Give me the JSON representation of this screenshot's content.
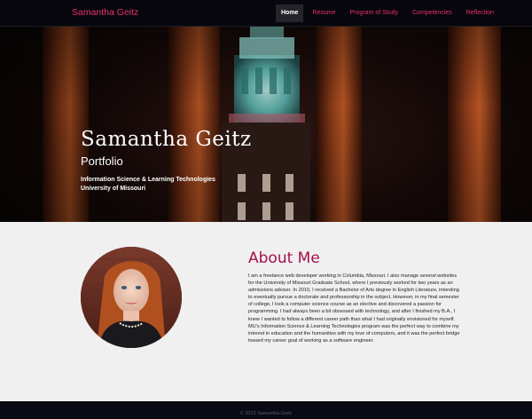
{
  "navbar": {
    "brand": "Samantha Geitz",
    "items": [
      {
        "label": "Home",
        "active": true
      },
      {
        "label": "Resume",
        "active": false
      },
      {
        "label": "Program of Study",
        "active": false
      },
      {
        "label": "Competencies",
        "active": false
      },
      {
        "label": "Reflection",
        "active": false
      }
    ]
  },
  "hero": {
    "name": "Samantha Geitz",
    "subtitle": "Portfolio",
    "line1": "Information Science & Learning Technologies",
    "line2": "University of Missouri"
  },
  "about": {
    "title": "About Me",
    "body": "I am a freelance web developer working in Columbia, Missouri. I also manage several websites for the University of Missouri Graduate School, where I previously worked for two years as an admissions adviser. In 2010, I received a Bachelor of Arts degree in English Literature, intending to eventually pursue a doctorate and professorship in the subject. However, in my final semester of college, I took a computer science course as an elective and discovered a passion for programming. I had always been a bit obsessed with technology, and after I finished my B.A., I knew I wanted to follow a different career path than what I had originally envisioned for myself. MU's Information Science & Learning Technologies program was the perfect way to combine my interest in education and the humanities with my love of computers, and it was the perfect bridge toward my career goal of working as a software engineer."
  },
  "footer": {
    "text": "© 2013 Samantha Geitz"
  },
  "colors": {
    "accent": "#e8306e",
    "heading": "#a30f4c",
    "navbar_bg": "#07070d",
    "footer_bg": "#0a0a14"
  }
}
